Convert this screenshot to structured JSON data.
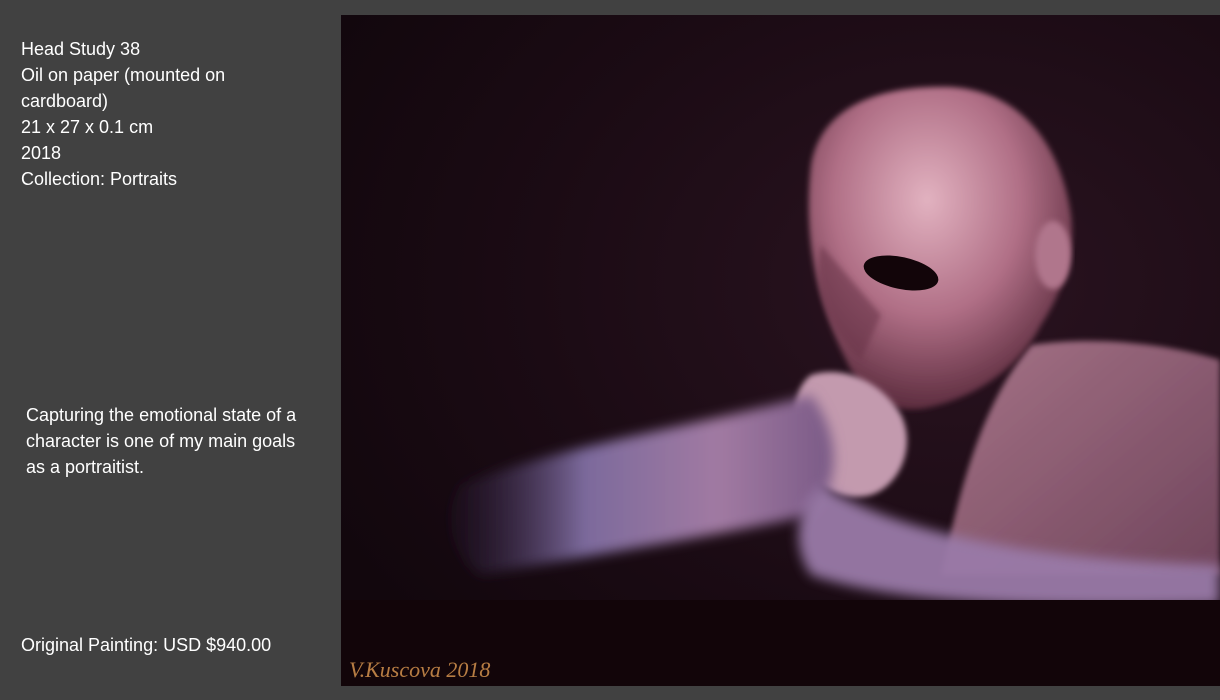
{
  "artwork": {
    "title": "Head Study 38",
    "medium": "Oil on paper (mounted on\ncardboard)",
    "dimensions": "21 x 27 x 0.1 cm",
    "year": "2018",
    "collection": "Collection: Portraits",
    "statement": "Capturing the emotional state of a character is one of my main goals as a portraitist.",
    "price_label": "Original Painting: USD $940.00",
    "signature": "V.Kuscova 2018"
  },
  "colors": {
    "page_background": "#414141",
    "canvas_background": "#1a0a12",
    "text": "#ffffff"
  }
}
